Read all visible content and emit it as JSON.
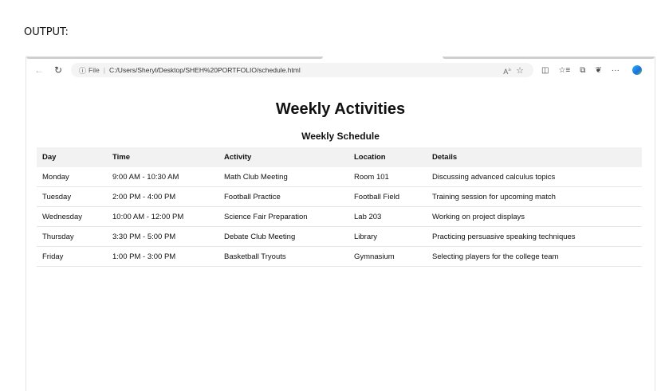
{
  "caption": "OUTPUT:",
  "browser": {
    "address_info": "ⓘ",
    "address_scheme": "File",
    "address_url": "C:/Users/Sheryl/Desktop/SHEH%20PORTFOLIO/schedule.html"
  },
  "page": {
    "title": "Weekly Activities",
    "subtitle": "Weekly Schedule",
    "columns": [
      "Day",
      "Time",
      "Activity",
      "Location",
      "Details"
    ],
    "rows": [
      [
        "Monday",
        "9:00 AM - 10:30 AM",
        "Math Club Meeting",
        "Room 101",
        "Discussing advanced calculus topics"
      ],
      [
        "Tuesday",
        "2:00 PM - 4:00 PM",
        "Football Practice",
        "Football Field",
        "Training session for upcoming match"
      ],
      [
        "Wednesday",
        "10:00 AM - 12:00 PM",
        "Science Fair Preparation",
        "Lab 203",
        "Working on project displays"
      ],
      [
        "Thursday",
        "3:30 PM - 5:00 PM",
        "Debate Club Meeting",
        "Library",
        "Practicing persuasive speaking techniques"
      ],
      [
        "Friday",
        "1:00 PM - 3:00 PM",
        "Basketball Tryouts",
        "Gymnasium",
        "Selecting players for the college team"
      ]
    ]
  }
}
